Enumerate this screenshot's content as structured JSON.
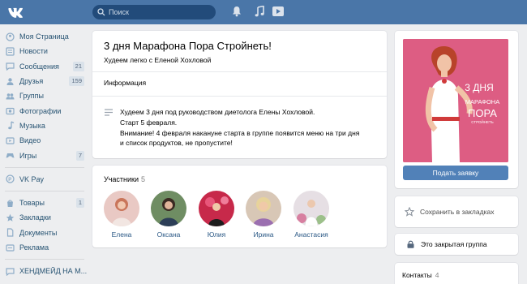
{
  "header": {
    "search_placeholder": "Поиск",
    "icons": [
      "vk-logo-icon",
      "search-icon",
      "bell-icon",
      "music-note-icon",
      "play-icon"
    ]
  },
  "sidebar": {
    "items": [
      {
        "label": "Моя Страница",
        "icon": "home-icon"
      },
      {
        "label": "Новости",
        "icon": "news-icon"
      },
      {
        "label": "Сообщения",
        "icon": "messages-icon",
        "count": "21"
      },
      {
        "label": "Друзья",
        "icon": "friends-icon",
        "count": "159"
      },
      {
        "label": "Группы",
        "icon": "groups-icon"
      },
      {
        "label": "Фотографии",
        "icon": "photo-icon"
      },
      {
        "label": "Музыка",
        "icon": "music-icon"
      },
      {
        "label": "Видео",
        "icon": "video-icon"
      },
      {
        "label": "Игры",
        "icon": "games-icon",
        "count": "7"
      }
    ],
    "pay": {
      "label": "VK Pay",
      "icon": "vkpay-icon"
    },
    "items2": [
      {
        "label": "Товары",
        "icon": "goods-icon",
        "count": "1"
      },
      {
        "label": "Закладки",
        "icon": "star-icon"
      },
      {
        "label": "Документы",
        "icon": "documents-icon"
      },
      {
        "label": "Реклама",
        "icon": "ads-icon"
      }
    ],
    "community": {
      "label": "ХЕНДМЕЙД НА М..."
    }
  },
  "group": {
    "title": "3 дня Марафона Пора Стройнеть!",
    "subtitle": "Худеем легко с Еленой Хохловой",
    "info_heading": "Информация",
    "description": [
      "Худеем 3 дня под руководством диетолога Елены Хохловой.",
      "Старт 5 февраля.",
      "Внимание! 4 февраля накануне старта в группе появится меню на три дня",
      "и список продуктов, не пропустите!"
    ]
  },
  "members": {
    "heading": "Участники",
    "count": "5",
    "list": [
      {
        "name": "Елена"
      },
      {
        "name": "Оксана"
      },
      {
        "name": "Юлия"
      },
      {
        "name": "Ирина"
      },
      {
        "name": "Анастасия"
      }
    ]
  },
  "right": {
    "cover_text": [
      "3 ДНЯ",
      "МАРАФОНА",
      "ПОРА",
      "СТРОЙНЕТЬ"
    ],
    "apply_button": "Подать заявку",
    "bookmark_label": "Сохранить в закладках",
    "closed_group_label": "Это закрытая группа",
    "contacts_label": "Контакты",
    "contacts_count": "4"
  },
  "colors": {
    "header": "#4a76a8",
    "link": "#2a5885",
    "button": "#5181b8",
    "background": "#edeef0",
    "cover": "#dd5d83"
  }
}
